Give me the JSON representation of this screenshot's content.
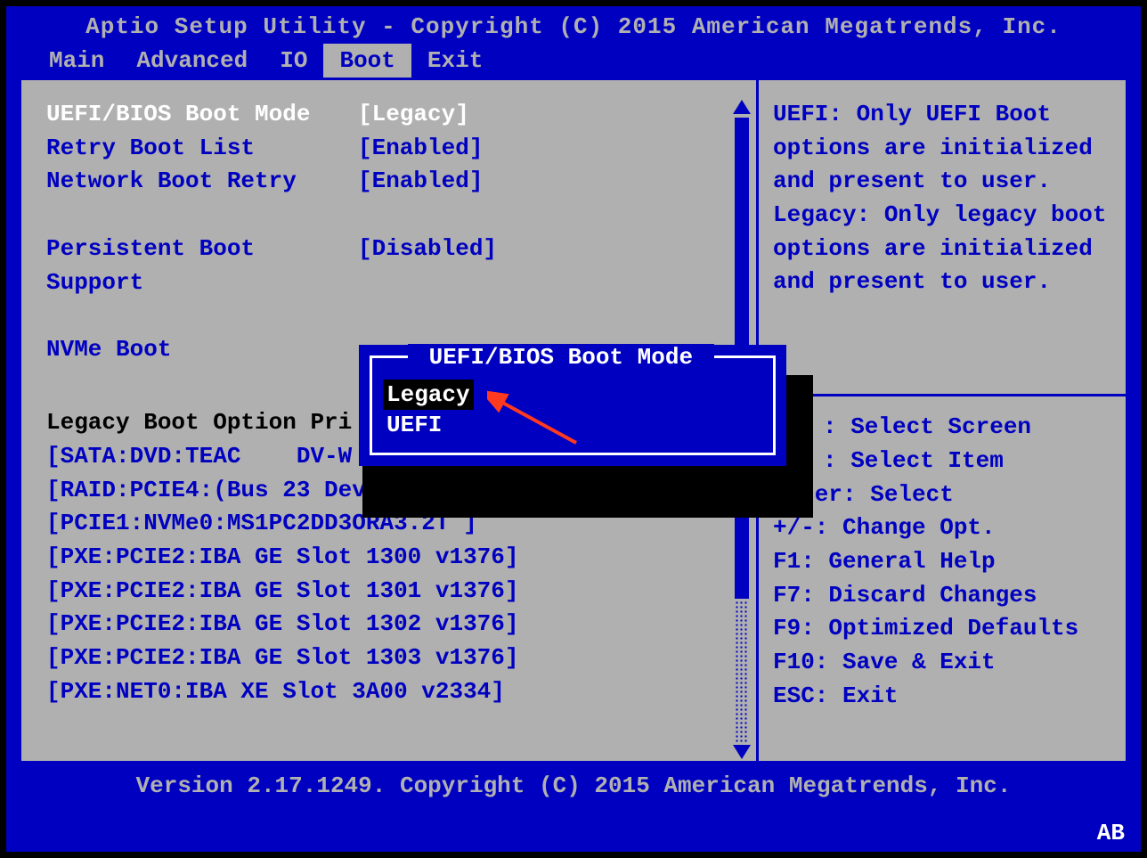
{
  "header": {
    "title": "Aptio Setup Utility - Copyright (C) 2015 American Megatrends, Inc."
  },
  "tabs": [
    "Main",
    "Advanced",
    "IO",
    "Boot",
    "Exit"
  ],
  "active_tab": "Boot",
  "settings": [
    {
      "label": "UEFI/BIOS Boot Mode",
      "value": "[Legacy]",
      "selected": true
    },
    {
      "label": "Retry Boot List",
      "value": "[Enabled]",
      "selected": false
    },
    {
      "label": "Network Boot Retry",
      "value": "[Enabled]",
      "selected": false
    }
  ],
  "settings2": [
    {
      "label": "Persistent Boot Support",
      "value": "[Disabled]",
      "selected": false,
      "multiline_label": [
        "Persistent Boot",
        "Support"
      ]
    }
  ],
  "settings3": [
    {
      "label": "NVMe Boot",
      "value": "",
      "selected": false
    }
  ],
  "section_header": "Legacy Boot Option Pri",
  "boot_items": [
    "[SATA:DVD:TEAC    DV-W",
    "[RAID:PCIE4:(Bus 23 Dev",
    "[PCIE1:NVMe0:MS1PC2DD3ORA3.2T ]",
    "[PXE:PCIE2:IBA GE Slot 1300 v1376]",
    "[PXE:PCIE2:IBA GE Slot 1301 v1376]",
    "[PXE:PCIE2:IBA GE Slot 1302 v1376]",
    "[PXE:PCIE2:IBA GE Slot 1303 v1376]",
    "[PXE:NET0:IBA XE Slot 3A00 v2334]"
  ],
  "help_text": "UEFI: Only UEFI Boot options are initialized and present to user. Legacy: Only legacy boot options are initialized and present to user.",
  "hints_top": [
    {
      "icon": "lr",
      "text": "Select Screen"
    },
    {
      "icon": "ud",
      "text": "Select Item"
    }
  ],
  "hints": [
    "Enter: Select",
    "+/-: Change Opt.",
    "F1: General Help",
    "F7: Discard Changes",
    "F9: Optimized Defaults",
    "F10: Save & Exit",
    "ESC: Exit"
  ],
  "popup": {
    "title": " UEFI/BIOS Boot Mode ",
    "options": [
      "Legacy",
      "UEFI"
    ],
    "selected": "Legacy"
  },
  "footer": {
    "text": "Version 2.17.1249. Copyright (C) 2015 American Megatrends, Inc."
  },
  "corner": "AB"
}
